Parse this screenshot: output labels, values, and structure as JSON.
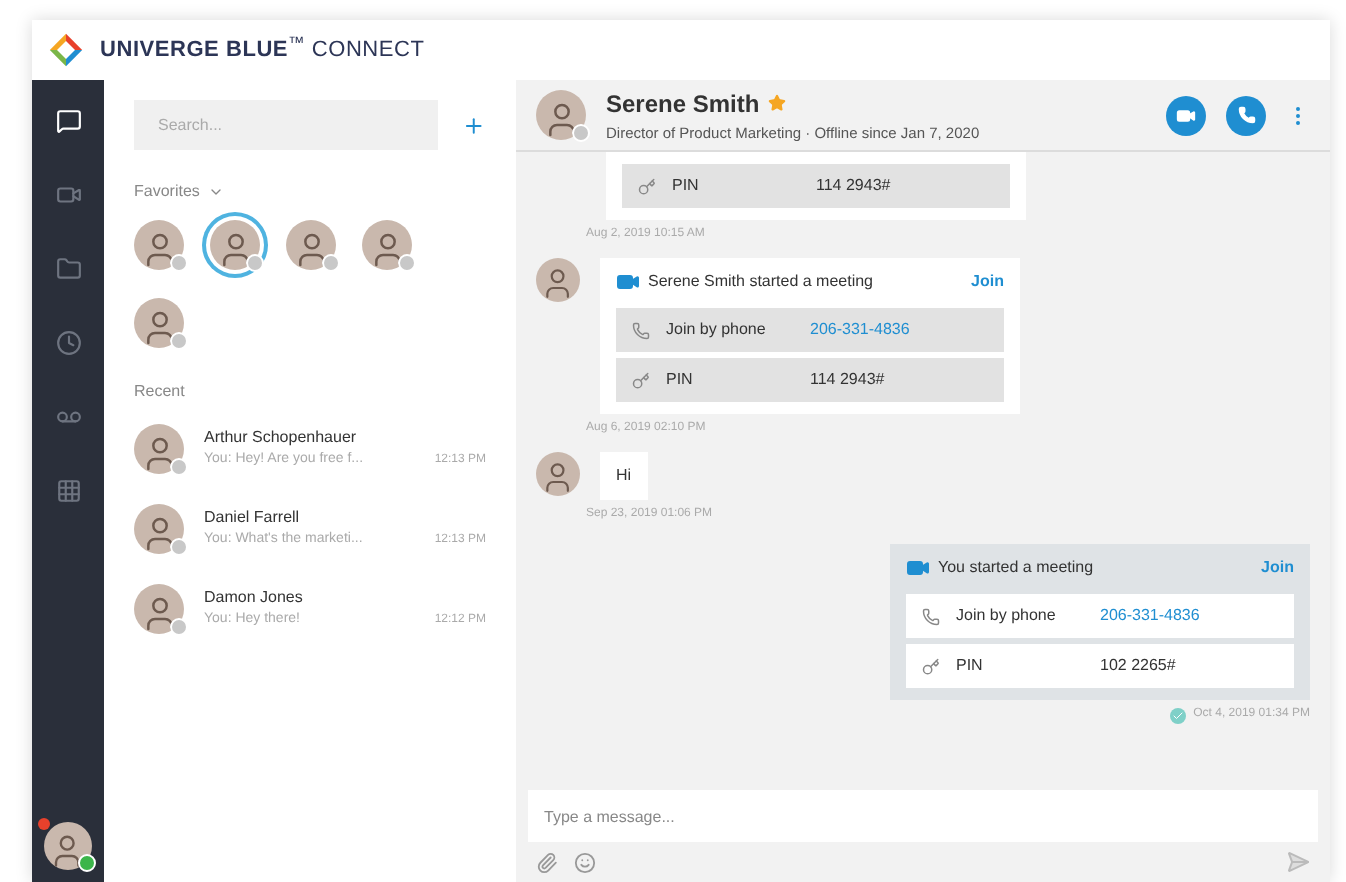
{
  "window": {
    "title": "**UNIVERGE BLUE**$^{™}$ CONNECT"
  },
  "rail": {
    "items": [
      {
        "kind": "chat",
        "selected": true
      },
      {
        "kind": "video",
        "selected": false
      },
      {
        "kind": "folder",
        "selected": false
      },
      {
        "kind": "history",
        "selected": false
      },
      {
        "kind": "voicemail",
        "selected": false
      },
      {
        "kind": "dialpad",
        "selected": false
      }
    ],
    "user": {
      "notification": true,
      "online": true
    }
  },
  "search": {
    "placeholder": "Search..."
  },
  "favorites": {
    "label": "Favorites",
    "items": [
      {
        "selected": false,
        "online": false
      },
      {
        "selected": true,
        "online": false
      },
      {
        "selected": false,
        "online": false
      },
      {
        "selected": false,
        "online": false
      },
      {
        "selected": false,
        "online": false
      }
    ]
  },
  "recent": {
    "label": "Recent",
    "items": [
      {
        "name": "Arthur Schopenhauer",
        "preview": "You: Hey! Are you free f...",
        "time": "12:13 PM",
        "online": false
      },
      {
        "name": "Daniel Farrell",
        "preview": "You: What's the marketi...",
        "time": "12:13 PM",
        "online": false
      },
      {
        "name": "Damon Jones",
        "preview": "You: Hey there!",
        "time": "12:12 PM",
        "online": false
      }
    ]
  },
  "chat_header": {
    "name": "Serene Smith",
    "favorite": true,
    "subtitle": "Director of Product Marketing · Offline since Jan 7, 2020"
  },
  "messages": [
    {
      "kind": "meeting_tail",
      "outgoing": false,
      "rows": [
        {
          "kind": "pin",
          "label": "PIN",
          "value": "114 2943#"
        }
      ],
      "timestamp": "Aug 2, 2019 10:15 AM"
    },
    {
      "kind": "meeting",
      "outgoing": false,
      "title": "Serene Smith started a meeting",
      "join": "Join",
      "rows": [
        {
          "kind": "phone",
          "label": "Join by phone",
          "value": "206-331-4836"
        },
        {
          "kind": "pin",
          "label": "PIN",
          "value": "114 2943#"
        }
      ],
      "timestamp": "Aug 6, 2019 02:10 PM"
    },
    {
      "kind": "text",
      "outgoing": false,
      "text": "Hi",
      "timestamp": "Sep 23, 2019 01:06 PM"
    },
    {
      "kind": "meeting",
      "outgoing": true,
      "title": "You started a meeting",
      "join": "Join",
      "rows": [
        {
          "kind": "phone",
          "label": "Join by phone",
          "value": "206-331-4836"
        },
        {
          "kind": "pin",
          "label": "PIN",
          "value": "102 2265#"
        }
      ],
      "timestamp": "Oct 4, 2019 01:34 PM",
      "read": true
    }
  ],
  "composer": {
    "placeholder": "Type a message..."
  }
}
